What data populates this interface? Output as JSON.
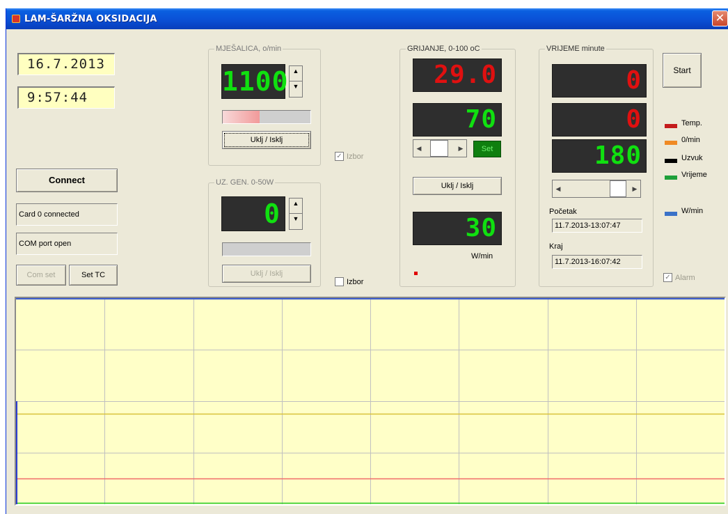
{
  "window": {
    "title": "LAM-ŠARŽNA OKSIDACIJA",
    "close_glyph": "✕"
  },
  "date": "16.7.2013",
  "time": "9:57:44",
  "connect_button": "Connect",
  "status": {
    "card": "Card 0 connected",
    "com_port": "COM port open"
  },
  "com_set_button": "Com set",
  "set_tc_button": "Set TC",
  "mixer": {
    "label": "MJEŠALICA, o/min",
    "value": "1100",
    "toggle_button": "Uklj / Isklj",
    "level": 0.42,
    "izbor_label": "Izbor",
    "izbor_checked": true
  },
  "ultrasound": {
    "label": "UZ. GEN. 0-50W",
    "value": "0",
    "toggle_button": "Uklj / Isklj",
    "level": 0,
    "izbor_label": "Izbor",
    "izbor_checked": false
  },
  "heating": {
    "label": "GRIJANJE, 0-100 oC",
    "current": "29.0",
    "setpoint": "70",
    "set_button": "Set",
    "toggle_button": "Uklj / Isklj",
    "rate": "30",
    "rate_unit": "W/min"
  },
  "time_group": {
    "label": "VRIJEME minute",
    "elapsed": "0",
    "remaining": "0",
    "duration": "180",
    "start_label": "Početak",
    "start_value": "11.7.2013-13:07:47",
    "end_label": "Kraj",
    "end_value": "11.7.2013-16:07:42"
  },
  "start_button": "Start",
  "legend": [
    {
      "label": "Temp.",
      "color": "#c41c1c"
    },
    {
      "label": "0/min",
      "color": "#f08a24"
    },
    {
      "label": "Uzvuk",
      "color": "#000000"
    },
    {
      "label": "Vrijeme",
      "color": "#1ea03a"
    },
    {
      "label": "W/min",
      "color": "#3a72c8"
    }
  ],
  "alarm": {
    "label": "Alarm",
    "checked": true
  },
  "plot": {
    "background": "#ffffc8",
    "grid_color": "#c0c0c0",
    "vertical_divisions": 8,
    "horizontal_divisions": 4,
    "lines": [
      {
        "name": "yellow-trace",
        "color": "#d8c23a",
        "level": 0.44
      },
      {
        "name": "red-trace",
        "color": "#f06a6a",
        "level": 0.12
      },
      {
        "name": "green-trace",
        "color": "#1ec81e",
        "level": 0.0
      }
    ]
  }
}
